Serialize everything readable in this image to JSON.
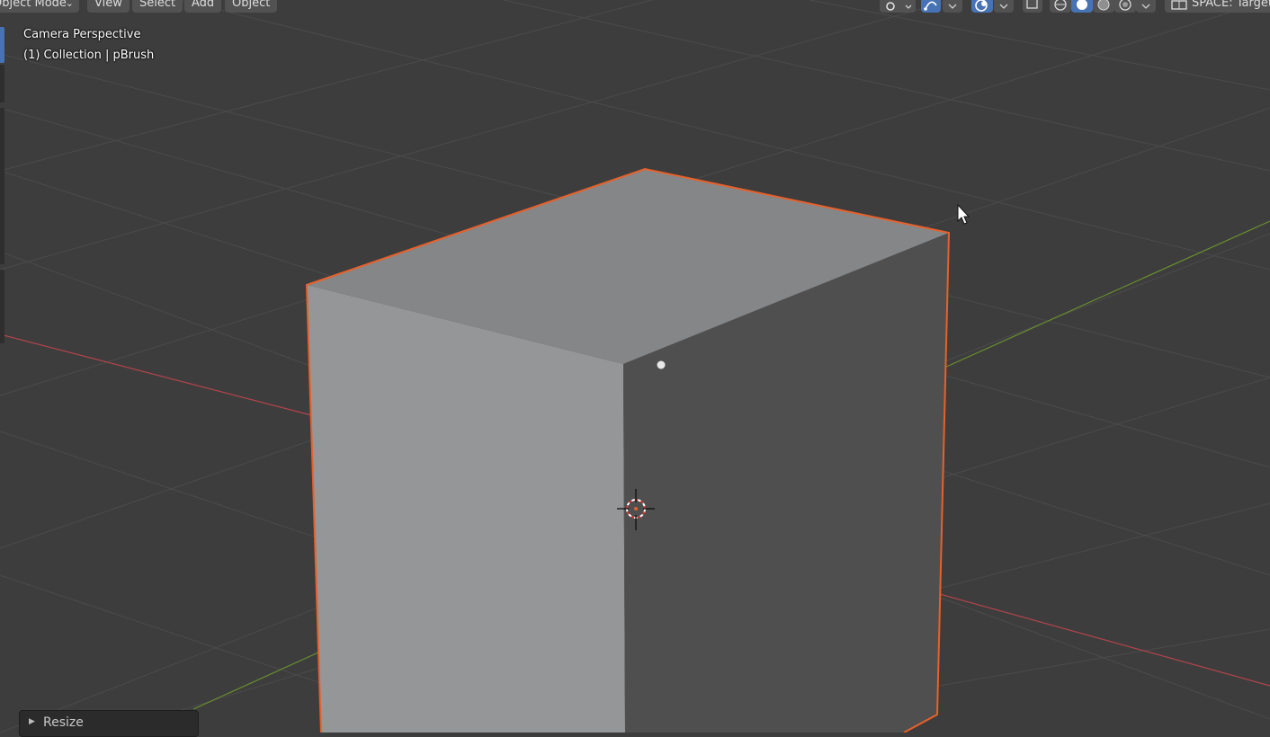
{
  "header": {
    "mode_label": "Object Mode",
    "menu": [
      "View",
      "Select",
      "Add",
      "Object"
    ],
    "space_label": "SPACE: Target"
  },
  "overlay": {
    "view_name": "Camera Perspective",
    "collection_info": "(1) Collection | pBrush"
  },
  "operator_panel": {
    "label": "Resize",
    "collapsed": true
  },
  "colors": {
    "background": "#3d3d3d",
    "grid": "#4a4a4a",
    "x_axis": "#b3444d",
    "y_axis": "#6a8f2e",
    "selection_outline": "#e8602a",
    "cube_top": "#858688",
    "cube_front": "#959697",
    "cube_side": "#4f4f4f",
    "accent": "#4772b3"
  },
  "icons": [
    "transform-pivot-icon",
    "snap-icon",
    "proportional-edit-icon",
    "overlays-icon",
    "xray-icon",
    "wireframe-shading-icon",
    "solid-shading-icon",
    "material-shading-icon",
    "rendered-shading-icon",
    "camera-view-icon",
    "3d-cursor-icon",
    "mouse-pointer-icon"
  ]
}
